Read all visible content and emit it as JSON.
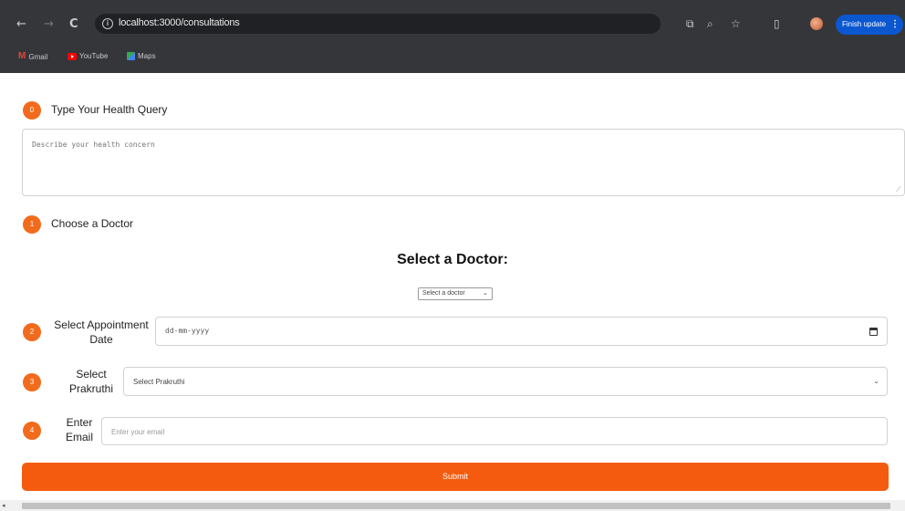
{
  "browser": {
    "back": "←",
    "forward": "→",
    "reload": "C",
    "url": "localhost:3000/consultations",
    "toolbar_icons": [
      "⧉",
      "⌕",
      "☆",
      "▯"
    ],
    "finish_update": "Finish update",
    "menu": "⋮"
  },
  "bookmarks": [
    {
      "label": "Gmail",
      "icon": "gmail-icon"
    },
    {
      "label": "YouTube",
      "icon": "youtube-icon"
    },
    {
      "label": "Maps",
      "icon": "maps-icon"
    }
  ],
  "steps": {
    "query": {
      "number": "0",
      "title": "Type Your Health Query",
      "placeholder": "Describe your health concern"
    },
    "doctor": {
      "number": "1",
      "title": "Choose a Doctor",
      "heading": "Select a Doctor:",
      "select_value": "Select a doctor"
    },
    "date": {
      "number": "2",
      "label_line1": "Select Appointment",
      "label_line2": "Date",
      "value": "dd-mm-yyyy"
    },
    "prakruthi": {
      "number": "3",
      "label_line1": "Select",
      "label_line2": "Prakruthi",
      "select_value": "Select Prakruthi"
    },
    "email": {
      "number": "4",
      "label_line1": "Enter",
      "label_line2": "Email",
      "placeholder": "Enter your email"
    }
  },
  "submit_label": "Submit",
  "colors": {
    "accent": "#f26b1d",
    "submit": "#f45b0e",
    "chrome": "#35363a"
  }
}
